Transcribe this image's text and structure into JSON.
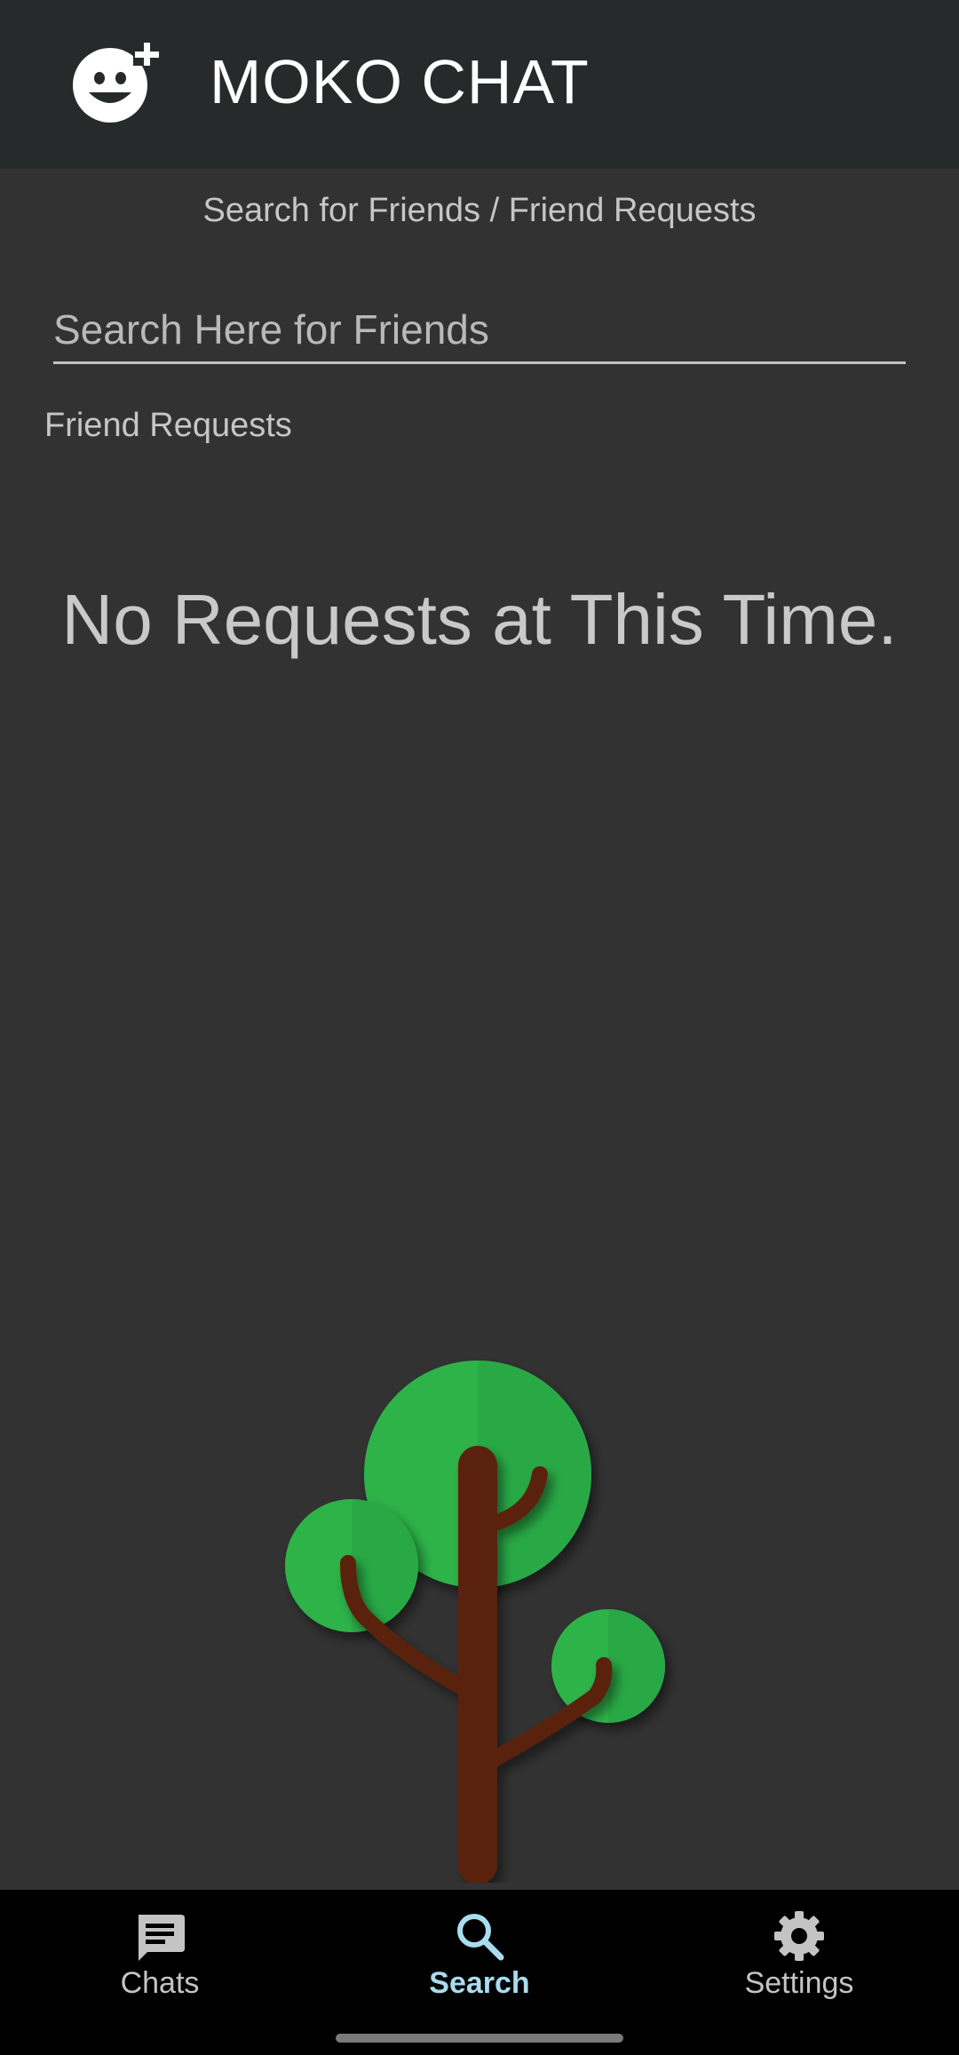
{
  "app_bar": {
    "title": "MOKO CHAT",
    "logo_icon": "add-friend-smiley-icon"
  },
  "page": {
    "subtitle": "Search for Friends / Friend Requests"
  },
  "search": {
    "placeholder": "Search Here for Friends",
    "value": ""
  },
  "friend_requests": {
    "label": "Friend Requests",
    "empty_message": "No Requests at This Time."
  },
  "illustration": {
    "icon": "tree-illustration"
  },
  "bottom_nav": {
    "items": [
      {
        "label": "Chats",
        "icon": "chat-icon",
        "active": false
      },
      {
        "label": "Search",
        "icon": "search-icon",
        "active": true
      },
      {
        "label": "Settings",
        "icon": "gear-icon",
        "active": false
      }
    ]
  },
  "colors": {
    "background": "#323232",
    "app_bar": "#262a2a",
    "nav_background": "#000000",
    "active_tab": "#a9dcef",
    "leaf_green": "#2db34a",
    "trunk_brown": "#5a230f"
  }
}
